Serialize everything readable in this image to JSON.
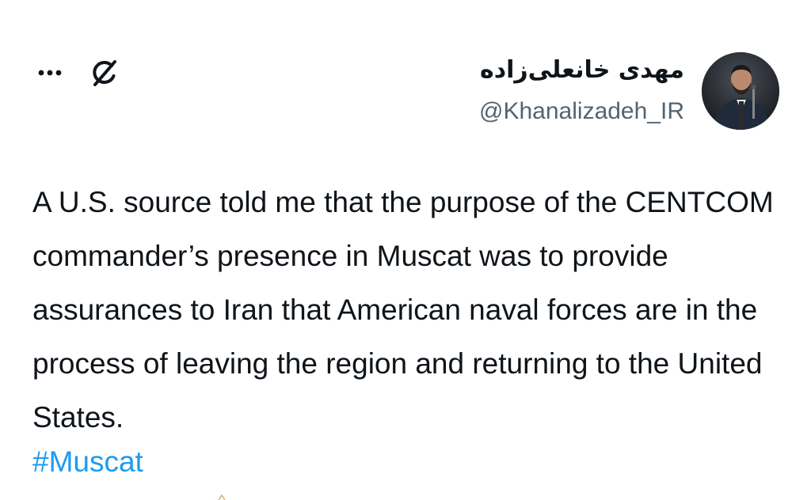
{
  "tweet": {
    "author": {
      "display_name": "مهدی خانعلی‌زاده",
      "handle": "@Khanalizadeh_IR",
      "avatar_icon": "avatar-photo"
    },
    "actions": {
      "grok_icon": "grok-icon",
      "more_icon": "more-dots-icon"
    },
    "text": "A U.S. source told me that the purpose of the CENTCOM commander’s presence in Muscat was to provide assurances to Iran that American naval forces are in the process of leaving the region and returning to the United States.",
    "hashtag": "#Muscat"
  },
  "colors": {
    "text": "#0f1419",
    "secondary": "#536471",
    "link": "#1d9bf0",
    "background": "#ffffff"
  }
}
